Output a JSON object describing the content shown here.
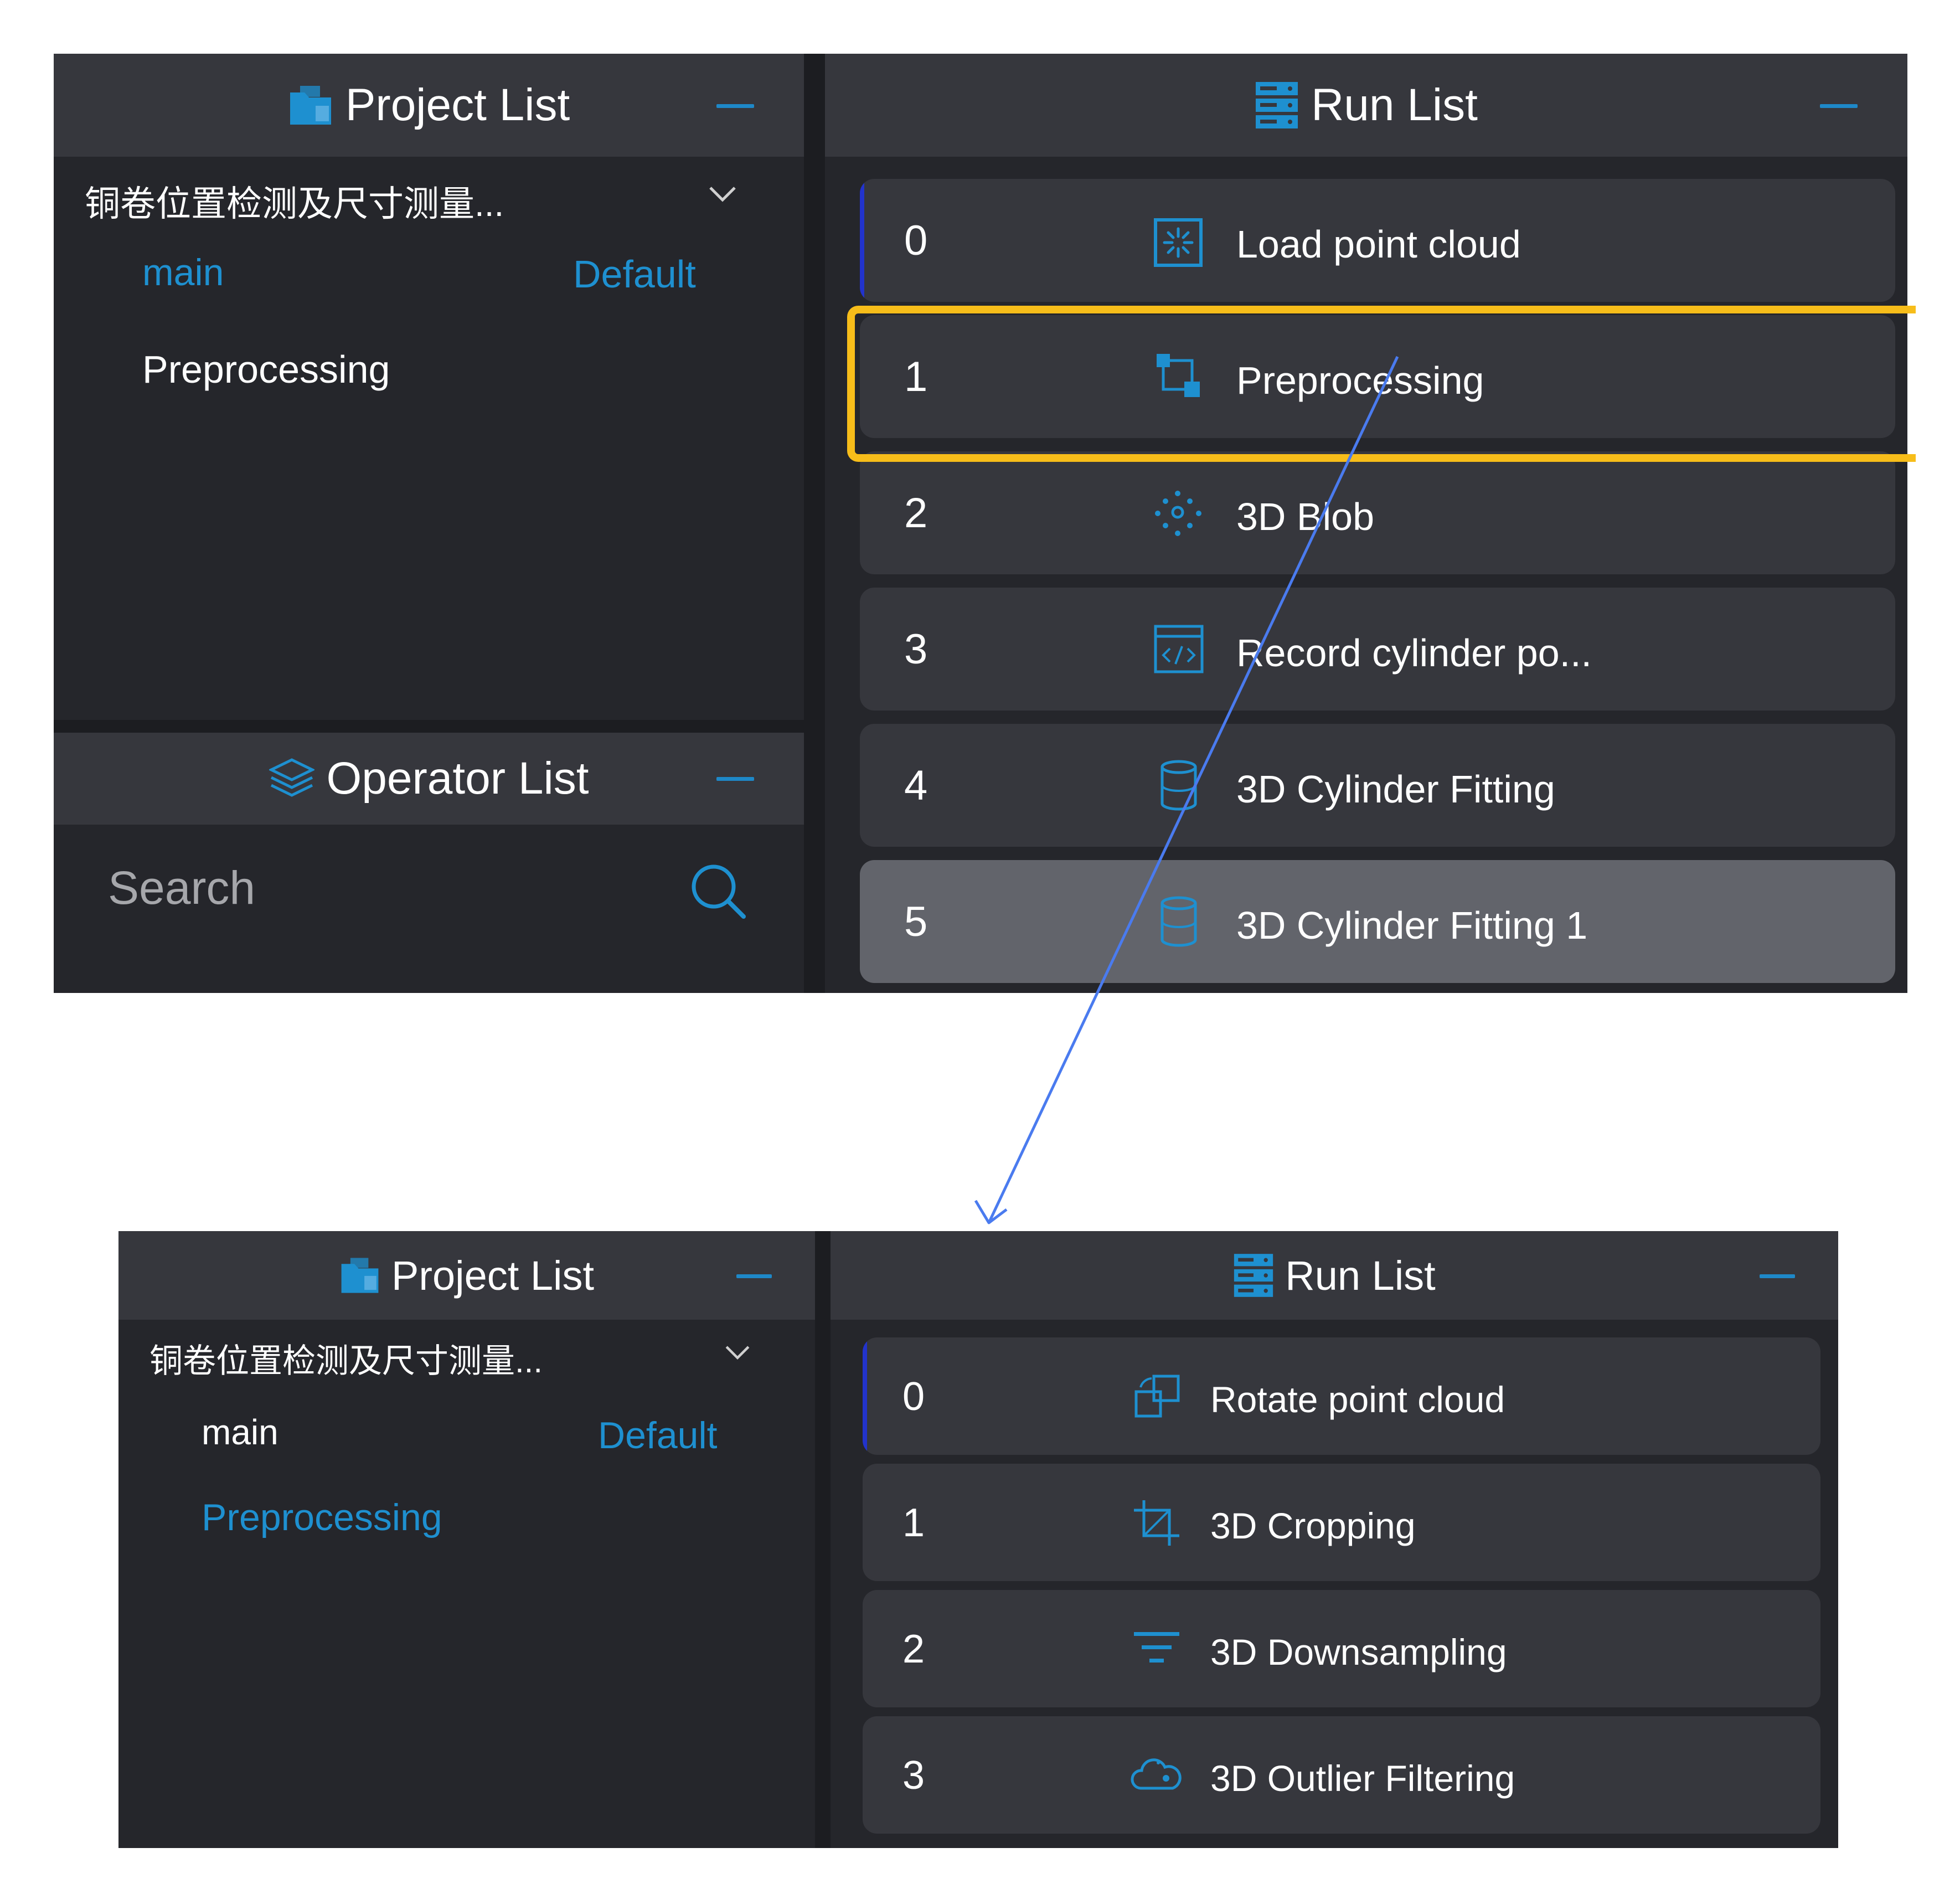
{
  "before": {
    "project_panel": {
      "title": "Project List",
      "project_name": "铜卷位置检测及尺寸测量...",
      "branch": "main",
      "default_label": "Default",
      "item": "Preprocessing"
    },
    "operator_panel": {
      "title": "Operator List",
      "search_placeholder": "Search"
    },
    "run_panel": {
      "title": "Run List",
      "steps": [
        {
          "index": "0",
          "label": "Load point cloud",
          "icon": "load-point-cloud-icon"
        },
        {
          "index": "1",
          "label": "Preprocessing",
          "icon": "preprocessing-icon"
        },
        {
          "index": "2",
          "label": "3D Blob",
          "icon": "blob-icon"
        },
        {
          "index": "3",
          "label": "Record cylinder po...",
          "icon": "code-icon"
        },
        {
          "index": "4",
          "label": "3D Cylinder Fitting",
          "icon": "cylinder-icon"
        },
        {
          "index": "5",
          "label": "3D Cylinder Fitting 1",
          "icon": "cylinder-icon"
        }
      ]
    }
  },
  "after": {
    "project_panel": {
      "title": "Project List",
      "project_name": "铜卷位置检测及尺寸测量...",
      "branch": "main",
      "default_label": "Default",
      "item": "Preprocessing"
    },
    "run_panel": {
      "title": "Run List",
      "steps": [
        {
          "index": "0",
          "label": "Rotate point cloud",
          "icon": "rotate-icon"
        },
        {
          "index": "1",
          "label": "3D Cropping",
          "icon": "crop-icon"
        },
        {
          "index": "2",
          "label": "3D Downsampling",
          "icon": "filter-icon"
        },
        {
          "index": "3",
          "label": "3D Outlier Filtering",
          "icon": "cloud-icon"
        }
      ]
    }
  },
  "colors": {
    "accent_blue": "#1e90d0",
    "highlight_yellow": "#f7bd1a",
    "arrow_blue": "#4a7bef",
    "panel_bg": "#25262b",
    "header_bg": "#36373d"
  }
}
